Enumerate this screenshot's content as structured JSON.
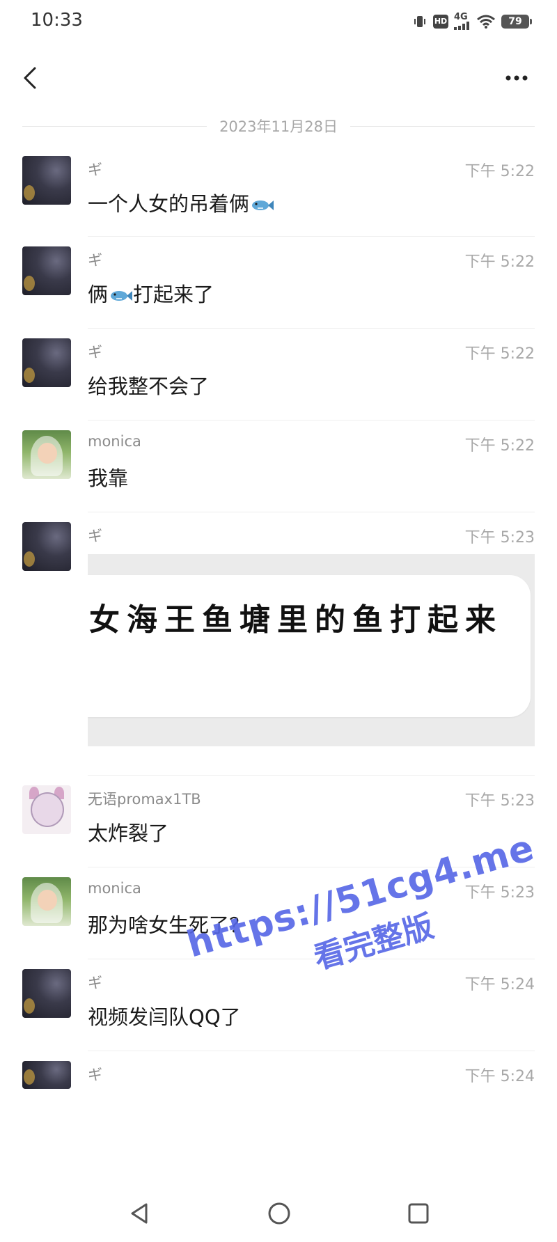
{
  "status_bar": {
    "time": "10:33",
    "hd_label": "HD",
    "network_label": "4G",
    "battery_level": "79",
    "icons": [
      "vibrate-icon",
      "hd-icon",
      "signal-icon",
      "wifi-icon",
      "battery-icon"
    ]
  },
  "header": {
    "back_icon": "chevron-left-icon",
    "more_icon": "more-dots-icon"
  },
  "date_divider": "2023年11月28日",
  "messages": [
    {
      "sender": "ギ",
      "time": "下午 5:22",
      "text": "一个人女的吊着俩",
      "emoji_after": "fish-icon",
      "avatar": "dark"
    },
    {
      "sender": "ギ",
      "time": "下午 5:22",
      "text_before": "俩",
      "emoji_mid": "fish-icon",
      "text_after": "打起来了",
      "avatar": "dark"
    },
    {
      "sender": "ギ",
      "time": "下午 5:22",
      "text": "给我整不会了",
      "avatar": "dark"
    },
    {
      "sender": "monica",
      "time": "下午 5:22",
      "text": "我靠",
      "avatar": "green"
    },
    {
      "sender": "ギ",
      "time": "下午 5:23",
      "sticker_text": "女海王鱼塘里的鱼打起来",
      "avatar": "dark"
    },
    {
      "sender": "无语promax1TB",
      "time": "下午 5:23",
      "text": "太炸裂了",
      "avatar": "anime"
    },
    {
      "sender": "monica",
      "time": "下午 5:23",
      "text": "那为啥女生死了？",
      "avatar": "green"
    },
    {
      "sender": "ギ",
      "time": "下午 5:24",
      "text": "视频发闫队QQ了",
      "avatar": "dark"
    },
    {
      "sender": "ギ",
      "time": "下午 5:24",
      "text": "",
      "avatar": "dark"
    }
  ],
  "watermark": {
    "url": "https://51cg4.me",
    "subtitle": "看完整版",
    "color": "#5566e6"
  },
  "system_nav": {
    "back_icon": "triangle-back-icon",
    "home_icon": "circle-home-icon",
    "recents_icon": "square-recents-icon"
  }
}
